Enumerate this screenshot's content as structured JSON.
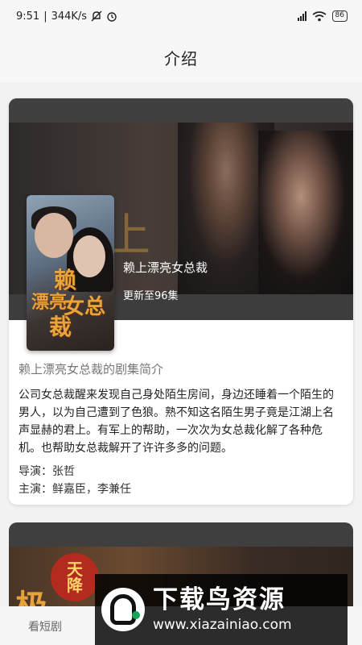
{
  "status_bar": {
    "time": "9:51",
    "speed": "344K/s",
    "battery": "86"
  },
  "header": {
    "title": "介绍"
  },
  "drama": {
    "name": "赖上漂亮女总裁",
    "update": "更新至96集",
    "intro_title": "赖上漂亮女总裁的剧集简介",
    "description": "公司女总裁醒来发现自己身处陌生房间，身边还睡着一个陌生的男人，以为自己遭到了色狼。熟不知这名陌生男子竟是江湖上名声显赫的君上。有军上的帮助，一次次为女总裁化解了各种危机。也帮助女总裁解开了许许多多的问题。",
    "director": "导演：张哲",
    "cast": "主演：鲜嘉臣，李兼任"
  },
  "poster_art": {
    "c1": "赖",
    "c2": "漂亮",
    "c3": "女总",
    "c4": "裁",
    "banner_char": "上"
  },
  "next_card": {
    "char": "极",
    "seal_top": "天",
    "seal_bottom": "降"
  },
  "bottom_tab": {
    "label": "看短剧"
  },
  "watermark": {
    "title": "下载鸟资源",
    "url": "www.xiazainiao.com"
  }
}
